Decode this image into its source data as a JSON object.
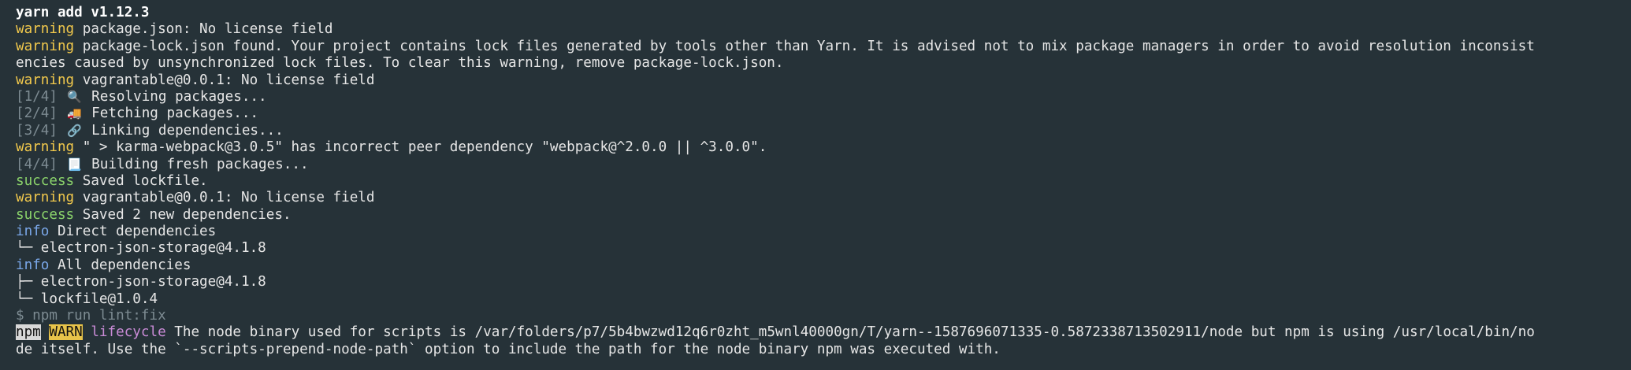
{
  "terminal": {
    "lines": [
      {
        "type": "header",
        "text": "yarn add v1.12.3"
      },
      {
        "type": "warn",
        "tag": "warning",
        "text": " package.json: No license field"
      },
      {
        "type": "warn",
        "tag": "warning",
        "text": " package-lock.json found. Your project contains lock files generated by tools other than Yarn. It is advised not to mix package managers in order to avoid resolution inconsist"
      },
      {
        "type": "plain",
        "text": "encies caused by unsynchronized lock files. To clear this warning, remove package-lock.json."
      },
      {
        "type": "warn",
        "tag": "warning",
        "text": " vagrantable@0.0.1: No license field"
      },
      {
        "type": "step",
        "step": "[1/4]",
        "icon": "🔍",
        "text": " Resolving packages..."
      },
      {
        "type": "step",
        "step": "[2/4]",
        "icon": "🚚",
        "text": " Fetching packages..."
      },
      {
        "type": "step",
        "step": "[3/4]",
        "icon": "🔗",
        "text": " Linking dependencies..."
      },
      {
        "type": "warn",
        "tag": "warning",
        "text": " \" > karma-webpack@3.0.5\" has incorrect peer dependency \"webpack@^2.0.0 || ^3.0.0\"."
      },
      {
        "type": "step",
        "step": "[4/4]",
        "icon": "📃",
        "text": " Building fresh packages..."
      },
      {
        "type": "success",
        "tag": "success",
        "text": " Saved lockfile."
      },
      {
        "type": "warn",
        "tag": "warning",
        "text": " vagrantable@0.0.1: No license field"
      },
      {
        "type": "success",
        "tag": "success",
        "text": " Saved 2 new dependencies."
      },
      {
        "type": "info",
        "tag": "info",
        "text": " Direct dependencies"
      },
      {
        "type": "plain",
        "text": "└─ electron-json-storage@4.1.8"
      },
      {
        "type": "info",
        "tag": "info",
        "text": " All dependencies"
      },
      {
        "type": "plain",
        "text": "├─ electron-json-storage@4.1.8"
      },
      {
        "type": "plain",
        "text": "└─ lockfile@1.0.4"
      },
      {
        "type": "prompt",
        "text": "$ npm run lint:fix"
      },
      {
        "type": "npm",
        "npm": "npm",
        "warn": "WARN",
        "lifecycle": "lifecycle",
        "text": " The node binary used for scripts is /var/folders/p7/5b4bwzwd12q6r0zht_m5wnl40000gn/T/yarn--1587696071335-0.5872338713502911/node but npm is using /usr/local/bin/no"
      },
      {
        "type": "plain",
        "text": "de itself. Use the `--scripts-prepend-node-path` option to include the path for the node binary npm was executed with."
      }
    ]
  }
}
